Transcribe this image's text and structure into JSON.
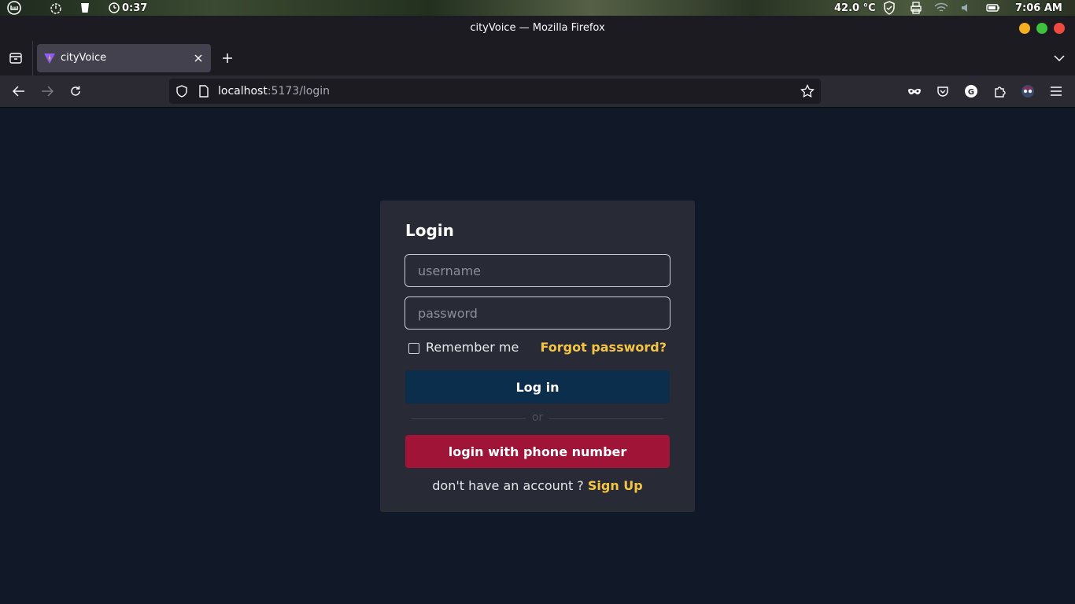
{
  "system_panel": {
    "timer": "0:37",
    "temperature": "42.0 °C",
    "clock": "7:06 AM"
  },
  "window": {
    "title": "cityVoice — Mozilla Firefox"
  },
  "tabs": [
    {
      "title": "cityVoice",
      "active": true
    }
  ],
  "navbar": {
    "url_host": "localhost",
    "url_rest": ":5173/login"
  },
  "login": {
    "heading": "Login",
    "username_placeholder": "username",
    "password_placeholder": "password",
    "remember_label": "Remember me",
    "remember_checked": false,
    "forgot_label": "Forgot password?",
    "login_button": "Log in",
    "divider_text": "or",
    "phone_button": "login with phone number",
    "signup_prompt": "don't have an account ? ",
    "signup_link": "Sign Up"
  },
  "colors": {
    "page_bg": "#111827",
    "card_bg": "#282a36",
    "accent_yellow": "#f5c542",
    "login_button": "#0b2e4c",
    "phone_button": "#a01437"
  }
}
